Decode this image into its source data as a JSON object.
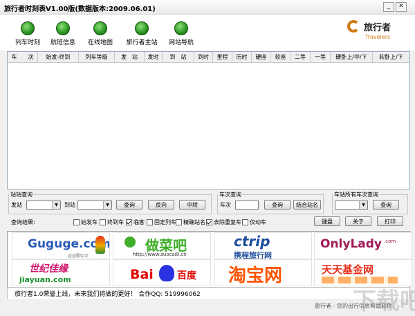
{
  "window": {
    "title": "旅行者时刻表V1.00版(数据版本:2009.06.01)"
  },
  "toolbar": {
    "items": [
      {
        "label": "列车时刻"
      },
      {
        "label": "航班信息"
      },
      {
        "label": "在线地图"
      },
      {
        "label": "旅行者主站"
      },
      {
        "label": "网站导航"
      }
    ],
    "logo": {
      "cn": "旅行者",
      "en": "Travelers"
    }
  },
  "table": {
    "columns": [
      "车　　次",
      "始发-终到",
      "列车等级",
      "发　站",
      "发时",
      "到　站",
      "到时",
      "里程",
      "历时",
      "硬座",
      "软座",
      "二等",
      "一等",
      "硬卧上/中/下",
      "软卧上/下"
    ]
  },
  "station_query": {
    "legend": "站站查询",
    "from_label": "发站",
    "to_label": "到站",
    "query_button": "查询",
    "reverse_button": "反向",
    "transfer_button": "中转"
  },
  "train_query": {
    "legend": "车次查询",
    "train_label": "车次",
    "query_button": "查询",
    "combine_button": "结合站名"
  },
  "all_trains_query": {
    "legend": "车站所有车次查询",
    "query_button": "查询"
  },
  "result_bar": {
    "label": "查询结果:",
    "options": [
      {
        "label": "始发车",
        "checked": false
      },
      {
        "label": "终到车",
        "checked": false
      },
      {
        "label": "临客",
        "checked": true
      },
      {
        "label": "固定列车",
        "checked": false
      },
      {
        "label": "精确站名",
        "checked": false
      },
      {
        "label": "去除重复车",
        "checked": true
      },
      {
        "label": "仅动车",
        "checked": false
      }
    ],
    "keyboard_button": "键盘",
    "about_button": "关于",
    "print_button": "打印"
  },
  "ads": [
    {
      "text": "Guguge.com",
      "sub": "谷谷歌中文"
    },
    {
      "text": "做菜吧",
      "sub": "http://www.zuocai8.cn"
    },
    {
      "text": "ctrip",
      "sub": "携程旅行网"
    },
    {
      "text": "OnlyLady",
      "sub": ".com"
    },
    {
      "text": "世纪佳缘",
      "sub": "jiayuan.com"
    },
    {
      "text": "Bai",
      "sub": "百度"
    },
    {
      "text": "淘宝网",
      "sub": ""
    },
    {
      "text": "天天基金网",
      "sub": ""
    }
  ],
  "status": {
    "message": "旅行者1.0荣誉上线，未来我们将做的更好！ 合作QQ: 519996062"
  },
  "bottom": {
    "info": "旅行者 - 您的出行信息帮助软件"
  },
  "watermark": "下载吧"
}
